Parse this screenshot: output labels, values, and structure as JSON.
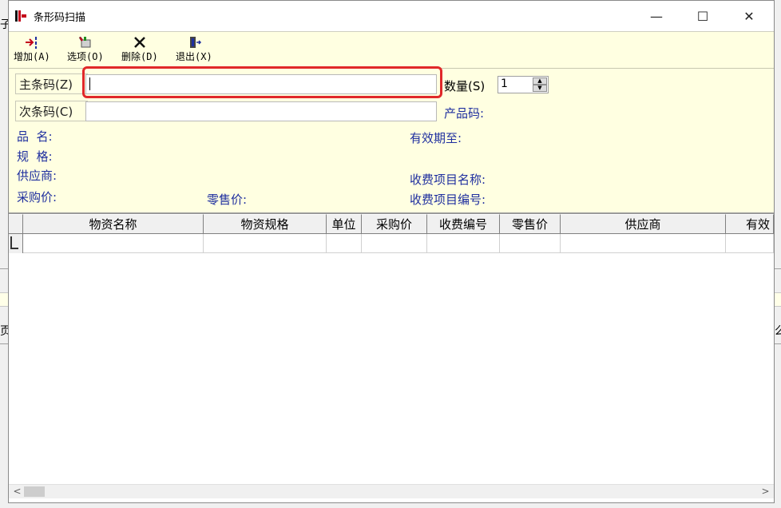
{
  "window": {
    "title": "条形码扫描",
    "controls": {
      "minimize": "—",
      "maximize": "☐",
      "close": "✕"
    }
  },
  "toolbar": {
    "items": [
      {
        "label": "增加(A)",
        "icon": "add-icon"
      },
      {
        "label": "选项(O)",
        "icon": "options-icon"
      },
      {
        "label": "删除(D)",
        "icon": "delete-icon"
      },
      {
        "label": "退出(X)",
        "icon": "exit-icon"
      }
    ]
  },
  "form": {
    "main_barcode_label": "主条码(Z)",
    "main_barcode_value": "",
    "sub_barcode_label": "次条码(C)",
    "sub_barcode_value": "",
    "quantity_label": "数量(S)",
    "quantity_value": "1",
    "product_code_label": "产品码:",
    "name_label": "品  名:",
    "spec_label": "规  格:",
    "supplier_label": "供应商:",
    "purchase_price_label": "采购价:",
    "retail_price_label": "零售价:",
    "expiry_label": "有效期至:",
    "fee_item_name_label": "收费项目名称:",
    "fee_item_code_label": "收费项目编号:"
  },
  "grid": {
    "columns": [
      "物资名称",
      "物资规格",
      "单位",
      "采购价",
      "收费编号",
      "零售价",
      "供应商",
      "有效"
    ]
  },
  "background": {
    "frag_left_top": "子",
    "frag_left_mid": "页",
    "frag_right_mid": "么"
  },
  "colors": {
    "form_bg": "#ffffe1",
    "label_blue": "#1f2f9f",
    "focus_red": "#e0282a"
  }
}
